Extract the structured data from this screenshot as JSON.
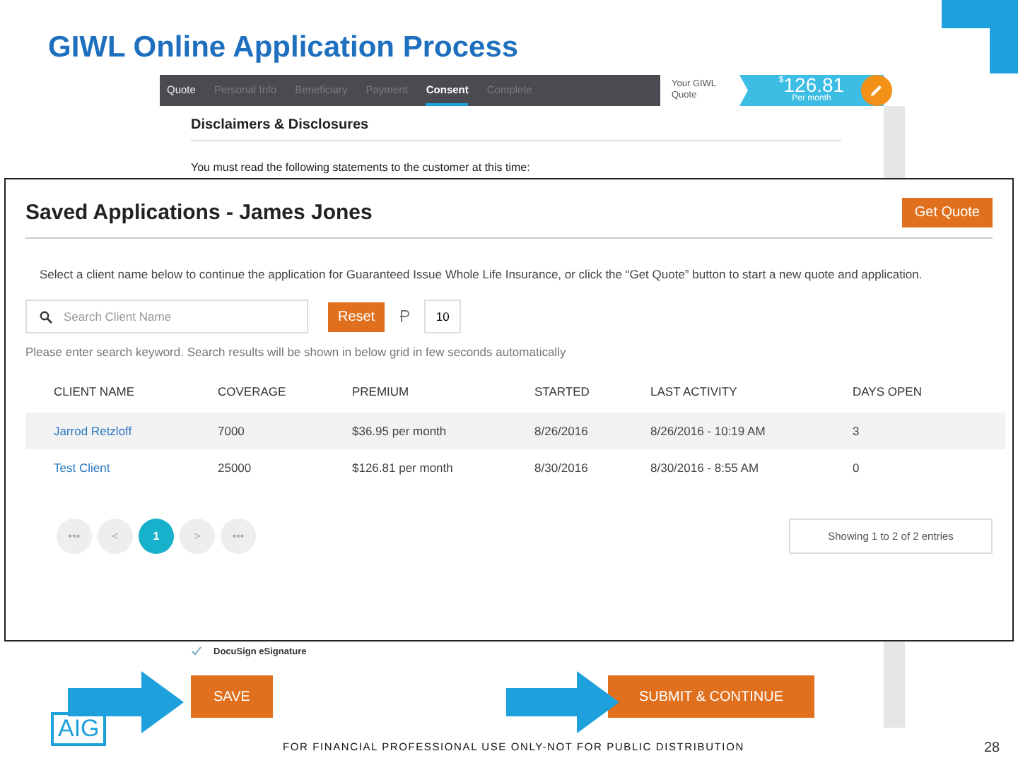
{
  "slide_title": "GIWL Online Application Process",
  "app": {
    "tabs": [
      {
        "label": "Quote",
        "selected": false,
        "completed": true
      },
      {
        "label": "Personal Info",
        "selected": false,
        "completed": false
      },
      {
        "label": "Beneficiary",
        "selected": false,
        "completed": false
      },
      {
        "label": "Payment",
        "selected": false,
        "completed": false
      },
      {
        "label": "Consent",
        "selected": true,
        "completed": false
      },
      {
        "label": "Complete",
        "selected": false,
        "completed": false
      }
    ],
    "quote_label": "Your GIWL Quote",
    "quote_currency": "$",
    "quote_amount": "126.81",
    "quote_period": "Per month",
    "heading": "Disclaimers & Disclosures",
    "notice": "You must read the following statements to the customer at this time:",
    "checklist": [
      {
        "label": "DocuSign eSignature",
        "checked": true
      }
    ],
    "buttons": [
      "SAVE",
      "SUBMIT & CONTINUE"
    ]
  },
  "dialog": {
    "title": "Saved Applications - James Jones",
    "get_quote": "Get Quote",
    "description": "Select a client name below to continue the application for Guaranteed Issue Whole Life Insurance, or click the “Get Quote” button to start a new quote and application.",
    "search": {
      "placeholder": "Search Client Name"
    },
    "reset": "Reset",
    "page_size": "10",
    "hint": "Please enter search keyword. Search results will be shown in below grid in few seconds automatically",
    "columns": [
      "CLIENT NAME",
      "COVERAGE",
      "PREMIUM",
      "STARTED",
      "LAST ACTIVITY",
      "DAYS OPEN"
    ],
    "rows": [
      {
        "selected": true,
        "cells": [
          "Jarrod Retzloff",
          "7000",
          "$36.95 per month",
          "8/26/2016",
          "8/26/2016 - 10:19 AM",
          "3"
        ]
      },
      {
        "selected": false,
        "cells": [
          "Test Client",
          "25000",
          "$126.81 per month",
          "8/30/2016",
          "8/30/2016 - 8:55 AM",
          "0"
        ]
      }
    ],
    "pagination": [
      {
        "label": "•••",
        "selected": false
      },
      {
        "label": "<",
        "selected": false
      },
      {
        "label": "1",
        "selected": true
      },
      {
        "label": ">",
        "selected": false
      },
      {
        "label": "•••",
        "selected": false
      }
    ],
    "entries": "Showing 1 to 2 of 2 entries"
  },
  "logo": "AIG",
  "footer": "FOR FINANCIAL PROFESSIONAL USE ONLY-NOT FOR PUBLIC DISTRIBUTION",
  "page_number": "28"
}
